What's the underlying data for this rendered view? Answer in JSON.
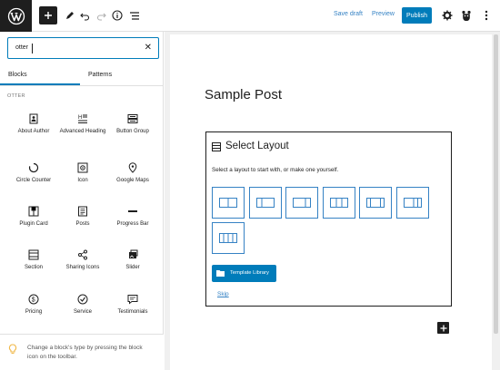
{
  "toolbar": {
    "save_draft": "Save draft",
    "preview": "Preview",
    "publish": "Publish"
  },
  "inserter": {
    "search_value": "otter",
    "tabs": [
      "Blocks",
      "Patterns"
    ],
    "section_label": "OTTER",
    "blocks": [
      {
        "label": "About Author",
        "icon": "about-author-icon"
      },
      {
        "label": "Advanced Heading",
        "icon": "advanced-heading-icon"
      },
      {
        "label": "Button Group",
        "icon": "button-group-icon"
      },
      {
        "label": "Circle Counter",
        "icon": "circle-counter-icon"
      },
      {
        "label": "Icon",
        "icon": "icon-block-icon"
      },
      {
        "label": "Google Maps",
        "icon": "google-maps-icon"
      },
      {
        "label": "Plugin Card",
        "icon": "plugin-card-icon"
      },
      {
        "label": "Posts",
        "icon": "posts-icon"
      },
      {
        "label": "Progress Bar",
        "icon": "progress-bar-icon"
      },
      {
        "label": "Section",
        "icon": "section-icon"
      },
      {
        "label": "Sharing Icons",
        "icon": "sharing-icons-icon"
      },
      {
        "label": "Slider",
        "icon": "slider-icon"
      },
      {
        "label": "Pricing",
        "icon": "pricing-icon"
      },
      {
        "label": "Service",
        "icon": "service-icon"
      },
      {
        "label": "Testimonials",
        "icon": "testimonials-icon"
      }
    ],
    "tip": "Change a block's type by pressing the block icon on the toolbar."
  },
  "editor": {
    "post_title": "Sample Post",
    "layout": {
      "title": "Select Layout",
      "subtitle": "Select a layout to start with, or make one yourself.",
      "template_library": "Template Library",
      "skip": "Skip"
    }
  },
  "colors": {
    "accent": "#007cba",
    "link": "#3582c4",
    "dark": "#1e1e1e"
  }
}
